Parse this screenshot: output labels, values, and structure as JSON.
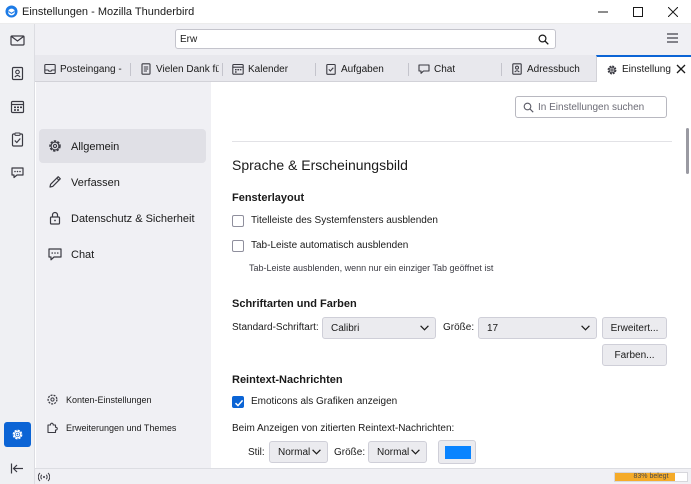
{
  "window": {
    "title": "Einstellungen - Mozilla Thunderbird"
  },
  "searchbar": {
    "value": "Erw"
  },
  "spaces": [
    {
      "name": "mail",
      "icon": "mail-icon"
    },
    {
      "name": "address-book",
      "icon": "address-book-icon"
    },
    {
      "name": "calendar",
      "icon": "calendar-icon"
    },
    {
      "name": "tasks",
      "icon": "tasks-icon"
    },
    {
      "name": "chat",
      "icon": "chat-icon"
    },
    {
      "name": "settings",
      "icon": "gear-icon",
      "active": true
    },
    {
      "name": "collapse",
      "icon": "collapse-icon"
    }
  ],
  "tabs": [
    {
      "label": "Posteingang - ",
      "icon": "inbox-icon"
    },
    {
      "label": "Vielen Dank für",
      "icon": "message-icon"
    },
    {
      "label": "Kalender",
      "icon": "calendar-icon"
    },
    {
      "label": "Aufgaben",
      "icon": "tasks-icon"
    },
    {
      "label": "Chat",
      "icon": "chat-icon"
    },
    {
      "label": "Adressbuch",
      "icon": "address-book-icon"
    },
    {
      "label": "Einstellunge",
      "icon": "gear-icon",
      "active": true
    }
  ],
  "sidebar": {
    "items": [
      {
        "label": "Allgemein",
        "icon": "gear-icon",
        "active": true
      },
      {
        "label": "Verfassen",
        "icon": "pencil-icon"
      },
      {
        "label": "Datenschutz & Sicherheit",
        "icon": "lock-icon"
      },
      {
        "label": "Chat",
        "icon": "chat-icon"
      }
    ],
    "footer": [
      {
        "label": "Konten-Einstellungen",
        "icon": "account-gear-icon"
      },
      {
        "label": "Erweiterungen und Themes",
        "icon": "puzzle-icon"
      }
    ]
  },
  "main": {
    "find_placeholder": "In Einstellungen suchen",
    "section_title": "Sprache & Erscheinungsbild",
    "window_layout": {
      "heading": "Fensterlayout",
      "titlebar_checkbox": {
        "label": "Titelleiste des Systemfensters ausblenden",
        "checked": false
      },
      "tabbar_checkbox": {
        "label": "Tab-Leiste automatisch ausblenden",
        "checked": false
      },
      "tabbar_hint": "Tab-Leiste ausblenden, wenn nur ein einziger Tab geöffnet ist"
    },
    "fonts": {
      "heading": "Schriftarten und Farben",
      "default_font_label": "Standard-Schriftart:",
      "default_font_value": "Calibri",
      "size_label": "Größe:",
      "size_value": "17",
      "advanced_button": "Erweitert...",
      "colors_button": "Farben..."
    },
    "plaintext": {
      "heading": "Reintext-Nachrichten",
      "emoticons_checkbox": {
        "label": "Emoticons als Grafiken anzeigen",
        "checked": true
      },
      "quoted_label": "Beim Anzeigen von zitierten Reintext-Nachrichten:",
      "style_label": "Stil:",
      "style_value": "Normal",
      "size_label": "Größe:",
      "size_value": "Normal",
      "quote_color": "#0a84ff"
    }
  },
  "status": {
    "quota_text": "83% belegt",
    "quota_percent": 83,
    "quota_color": "#f5ab29",
    "accent_color": "#0b64d5"
  }
}
